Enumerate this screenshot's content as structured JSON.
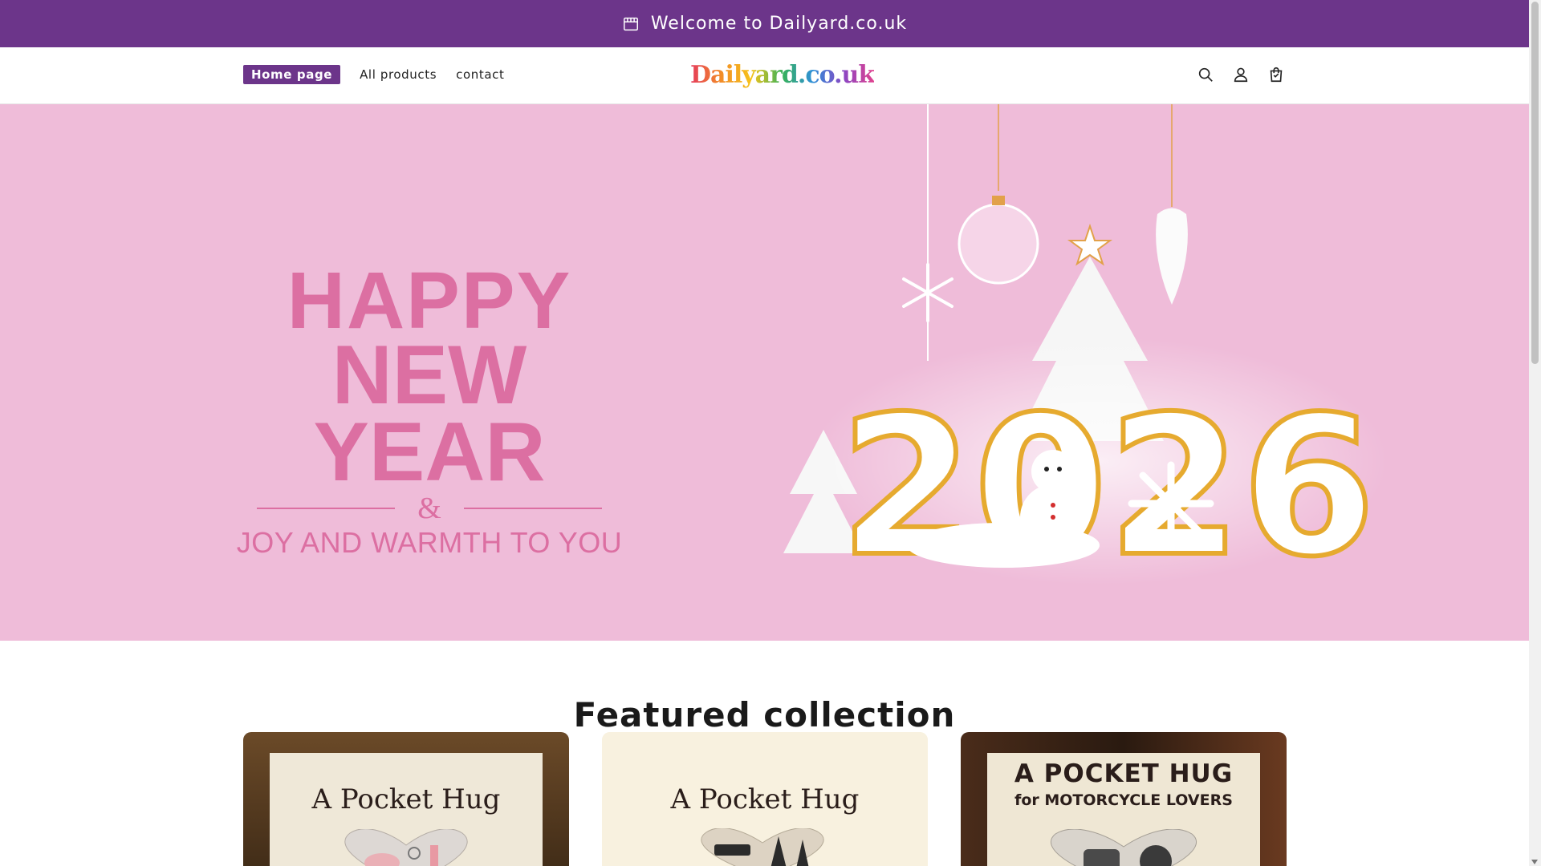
{
  "announcement": {
    "text": "Welcome to Dailyard.co.uk",
    "icon": "shop-icon"
  },
  "nav": {
    "items": [
      {
        "label": "Home page",
        "active": true
      },
      {
        "label": "All products",
        "active": false
      },
      {
        "label": "contact",
        "active": false
      }
    ]
  },
  "logo": {
    "text": "Dailyard.co.uk"
  },
  "header_icons": [
    "search-icon",
    "account-icon",
    "cart-icon"
  ],
  "hero": {
    "line1": "HAPPY",
    "line2": "NEW YEAR",
    "amp": "&",
    "line3": "JOY AND WARMTH TO YOU",
    "year": "2026"
  },
  "featured": {
    "title": "Featured collection",
    "cards": [
      {
        "title": "A Pocket Hug",
        "subtitle": ""
      },
      {
        "title": "A Pocket Hug",
        "subtitle": ""
      },
      {
        "title": "A POCKET HUG",
        "subtitle": "for MOTORCYCLE LOVERS"
      }
    ]
  },
  "colors": {
    "brand": "#6c358a",
    "hero_bg": "#efbcd9",
    "hero_text": "#dc6fa2"
  }
}
